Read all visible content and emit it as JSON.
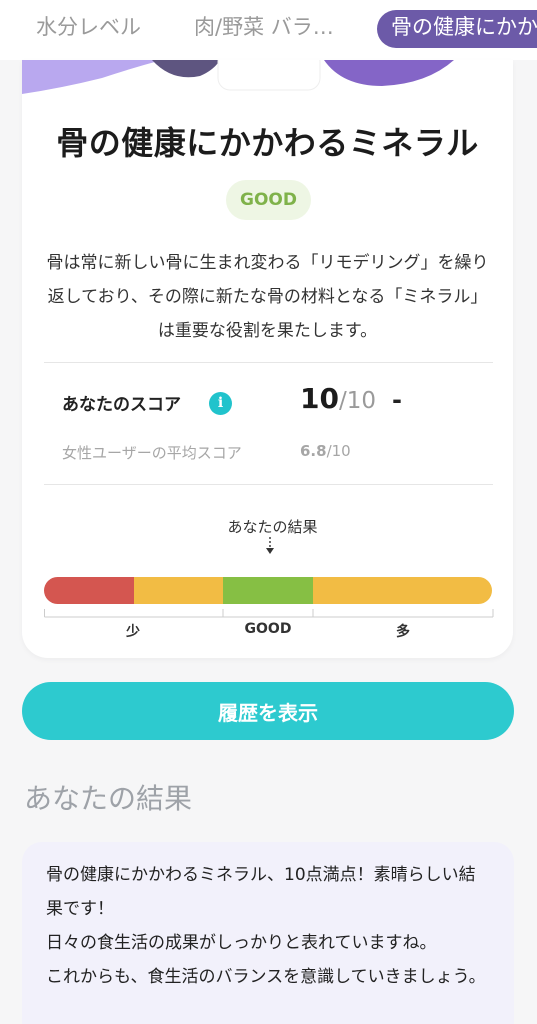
{
  "tabs": [
    {
      "label": "水分レベル",
      "active": false
    },
    {
      "label": "肉/野菜 バラ…",
      "active": false
    },
    {
      "label": "骨の健康にかか",
      "active": true
    }
  ],
  "card": {
    "title": "骨の健康にかかわるミネラル",
    "status": "GOOD",
    "description": "骨は常に新しい骨に生まれ変わる「リモデリング」を繰り返しており、その際に新たな骨の材料となる「ミネラル」は重要な役割を果たします。",
    "score": {
      "label": "あなたのスコア",
      "info_icon": "info-icon",
      "value": "10",
      "max": "/10",
      "change": "-"
    },
    "average": {
      "label": "女性ユーザーの平均スコア",
      "value": "6.8",
      "max": "/10"
    },
    "scale": {
      "marker_label": "あなたの結果",
      "low_label": "少",
      "good_label": "GOOD",
      "high_label": "多",
      "colors": {
        "low": "#d45650",
        "mid": "#f2bc44",
        "good": "#86bf44",
        "high": "#f2bc44"
      }
    }
  },
  "history_button": {
    "label": "履歴を表示"
  },
  "results": {
    "title": "あなたの結果",
    "text": "骨の健康にかかわるミネラル、10点満点！素晴らしい結果です！\n日々の食生活の成果がしっかりと表れていますね。\nこれからも、食生活のバランスを意識していきましょう。"
  },
  "colors": {
    "accent_purple": "#6c5aa8",
    "accent_teal": "#2dcacf",
    "good_green": "#7fb24a"
  }
}
